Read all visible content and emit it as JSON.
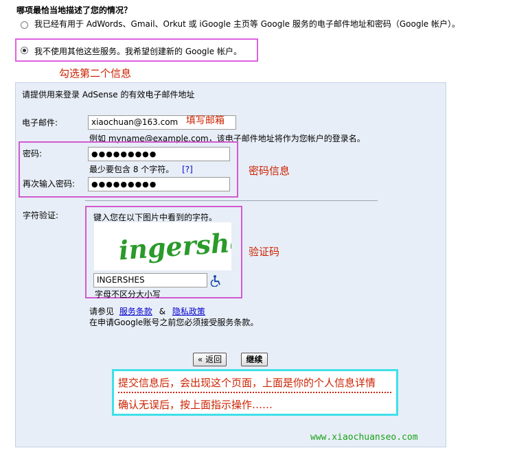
{
  "question": "哪项最恰当地描述了您的情况？",
  "options": [
    {
      "label": "我已经有用于 AdWords、Gmail、Orkut 或 iGoogle 主页等 Google 服务的电子邮件地址和密码（Google 帐户）。",
      "checked": false
    },
    {
      "label": "我不使用其他这些服务。我希望创建新的 Google 帐户。",
      "checked": true
    }
  ],
  "annotations": {
    "select_second": "勾选第二个信息",
    "fill_email": "填写邮箱",
    "password_info": "密码信息",
    "captcha": "验证码",
    "after_submit_line1": "提交信息后，会出现这个页面，上面是你的个人信息详情",
    "after_submit_line2": "确认无误后，按上面指示操作……"
  },
  "form": {
    "intro": "请提供用来登录 AdSense 的有效电子邮件地址",
    "email_label": "电子邮件:",
    "email_value": "xiaochuan@163.com",
    "email_hint": "例如  myname@example.com，该电子邮件地址将作为您帐户的登录名。",
    "password_label": "密码:",
    "password_value": "●●●●●●●●●",
    "password_hint": "最少要包含  8 个字符。",
    "password_help": "[?]",
    "confirm_label": "再次输入密码:",
    "confirm_value": "●●●●●●●●●",
    "captcha_label": "字符验证:",
    "captcha_instruction": "键入您在以下图片中看到的字符。",
    "captcha_image_text": "ingershes",
    "captcha_value": "INGERSHES",
    "captcha_case_note": "字母不区分大小写",
    "terms_prefix": "请参见",
    "terms_link": "服务条款",
    "terms_amp": "&",
    "privacy_link": "隐私政策",
    "terms_note": "在申请Google账号之前您必须接受服务条款。",
    "back_button": "« 返回",
    "continue_button": "继续"
  },
  "watermark": "www.xiaochuanseo.com",
  "colors": {
    "annotation_red": "#cc2200",
    "highlight_pink": "#d05ad0",
    "highlight_cyan": "#3fe0e8",
    "panel_bg": "#e8eef7"
  },
  "icons": {
    "accessibility": "wheelchair-icon"
  }
}
